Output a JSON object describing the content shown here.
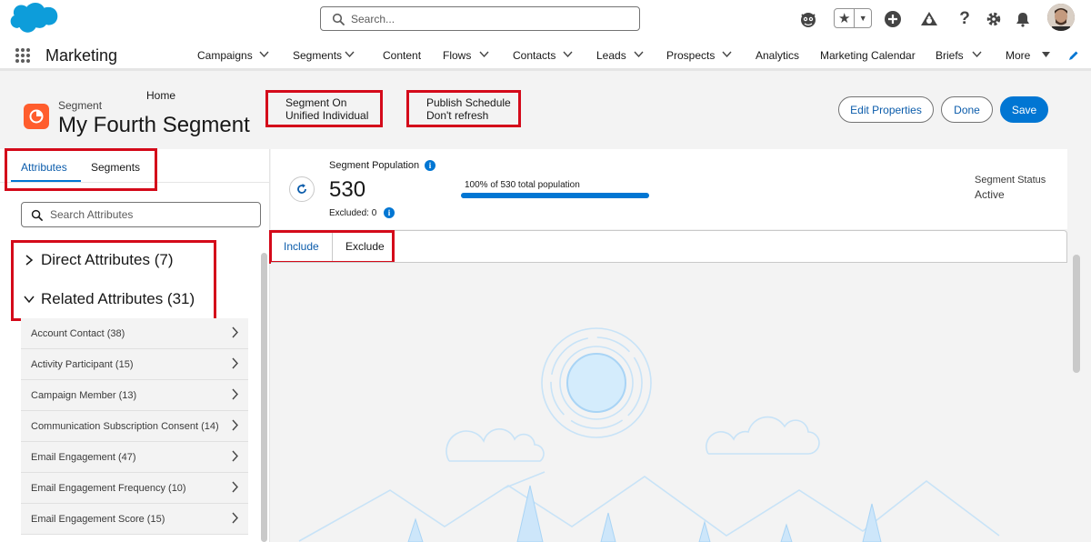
{
  "topbar": {
    "search_placeholder": "Search...",
    "icons": [
      "cloud-logo",
      "einstein-icon",
      "favorites-star-icon",
      "add-icon",
      "trailhead-icon",
      "help-icon",
      "setup-gear-icon",
      "notifications-bell-icon",
      "user-avatar"
    ]
  },
  "nav": {
    "app_name": "Marketing",
    "items": [
      {
        "label": "Home",
        "dropdown": false
      },
      {
        "label": "Campaigns",
        "dropdown": true
      },
      {
        "label": "Segments",
        "dropdown": true
      },
      {
        "label": "Content",
        "dropdown": false
      },
      {
        "label": "Flows",
        "dropdown": true
      },
      {
        "label": "Contacts",
        "dropdown": true
      },
      {
        "label": "Leads",
        "dropdown": true
      },
      {
        "label": "Prospects",
        "dropdown": true
      },
      {
        "label": "Analytics",
        "dropdown": false
      },
      {
        "label": "Marketing Calendar",
        "dropdown": false
      },
      {
        "label": "Briefs",
        "dropdown": true
      },
      {
        "label": "More",
        "dropdown": true
      }
    ]
  },
  "header": {
    "kicker": "Segment",
    "title": "My Fourth Segment",
    "segment_on_label": "Segment On",
    "segment_on_value": "Unified Individual",
    "publish_label": "Publish Schedule",
    "publish_value": "Don't refresh",
    "buttons": {
      "edit": "Edit Properties",
      "done": "Done",
      "save": "Save"
    }
  },
  "left_panel": {
    "tabs": [
      "Attributes",
      "Segments"
    ],
    "active_tab": "Attributes",
    "search_placeholder": "Search Attributes",
    "direct_attributes": "Direct Attributes (7)",
    "related_attributes": "Related Attributes (31)",
    "related_items": [
      "Account Contact (38)",
      "Activity Participant (15)",
      "Campaign Member (13)",
      "Communication Subscription Consent (14)",
      "Email Engagement (47)",
      "Email Engagement Frequency (10)",
      "Email Engagement Score (15)"
    ]
  },
  "population": {
    "label": "Segment Population",
    "value": "530",
    "excluded": "Excluded: 0",
    "progress_text": "100% of 530 total population",
    "progress_fraction": 1.0,
    "status_label": "Segment Status",
    "status_value": "Active"
  },
  "canvas": {
    "tabs": [
      "Include",
      "Exclude"
    ],
    "active_tab": "Include"
  },
  "colors": {
    "brand": "#0176d3",
    "highlight_box": "#d40a1a",
    "segment_icon": "#ff5d2d"
  }
}
